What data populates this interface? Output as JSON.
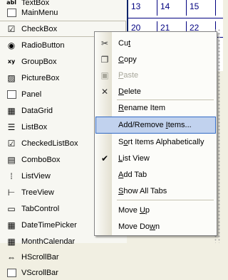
{
  "toolbox": {
    "items": [
      {
        "label": "TextBox",
        "icon": "textbox-icon",
        "glyph": "abl"
      },
      {
        "label": "MainMenu",
        "icon": "mainmenu-icon",
        "glyph": ""
      },
      {
        "label": "CheckBox",
        "icon": "checkbox-icon",
        "glyph": "☑"
      },
      {
        "label": "RadioButton",
        "icon": "radiobutton-icon",
        "glyph": "◉"
      },
      {
        "label": "GroupBox",
        "icon": "groupbox-icon",
        "glyph": "xy"
      },
      {
        "label": "PictureBox",
        "icon": "picturebox-icon",
        "glyph": "▨"
      },
      {
        "label": "Panel",
        "icon": "panel-icon",
        "glyph": ""
      },
      {
        "label": "DataGrid",
        "icon": "datagrid-icon",
        "glyph": "▦"
      },
      {
        "label": "ListBox",
        "icon": "listbox-icon",
        "glyph": "☰"
      },
      {
        "label": "CheckedListBox",
        "icon": "checkedlistbox-icon",
        "glyph": "☑"
      },
      {
        "label": "ComboBox",
        "icon": "combobox-icon",
        "glyph": "▤"
      },
      {
        "label": "ListView",
        "icon": "listview-icon",
        "glyph": "⁞"
      },
      {
        "label": "TreeView",
        "icon": "treeview-icon",
        "glyph": "⊢"
      },
      {
        "label": "TabControl",
        "icon": "tabcontrol-icon",
        "glyph": "▭"
      },
      {
        "label": "DateTimePicker",
        "icon": "datetimepicker-icon",
        "glyph": "▦"
      },
      {
        "label": "MonthCalendar",
        "icon": "monthcalendar-icon",
        "glyph": "▦"
      },
      {
        "label": "HScrollBar",
        "icon": "hscrollbar-icon",
        "glyph": "⇔"
      },
      {
        "label": "VScrollBar",
        "icon": "vscrollbar-icon",
        "glyph": ""
      }
    ],
    "selected_index": 2
  },
  "calendar": {
    "rows": [
      [
        "13",
        "14",
        "15"
      ],
      [
        "20",
        "21",
        "22"
      ]
    ]
  },
  "context_menu": {
    "items": [
      {
        "label": "Cut",
        "underline": "t",
        "icon": "scissors-icon"
      },
      {
        "label": "Copy",
        "underline": "C",
        "icon": "copy-icon"
      },
      {
        "label": "Paste",
        "underline": "P",
        "icon": "paste-icon",
        "disabled": true
      },
      {
        "label": "Delete",
        "underline": "D",
        "icon": "delete-x-icon"
      },
      {
        "label": "Rename Item",
        "underline": "R",
        "icon": ""
      },
      {
        "label": "Add/Remove Items...",
        "underline": "I",
        "icon": "",
        "highlighted": true
      },
      {
        "label": "Sort Items Alphabetically",
        "underline": "o",
        "icon": ""
      },
      {
        "label": "List View",
        "underline": "L",
        "icon": "checkmark-icon",
        "checked": true
      },
      {
        "label": "Add Tab",
        "underline": "A",
        "icon": ""
      },
      {
        "label": "Show All Tabs",
        "underline": "S",
        "icon": ""
      },
      {
        "label": "Move Up",
        "underline": "U",
        "icon": ""
      },
      {
        "label": "Move Down",
        "underline": "w",
        "icon": ""
      }
    ]
  },
  "colors": {
    "highlight": "#c1d2ee",
    "highlight_border": "#316ac5",
    "calendar_text": "#000080"
  }
}
